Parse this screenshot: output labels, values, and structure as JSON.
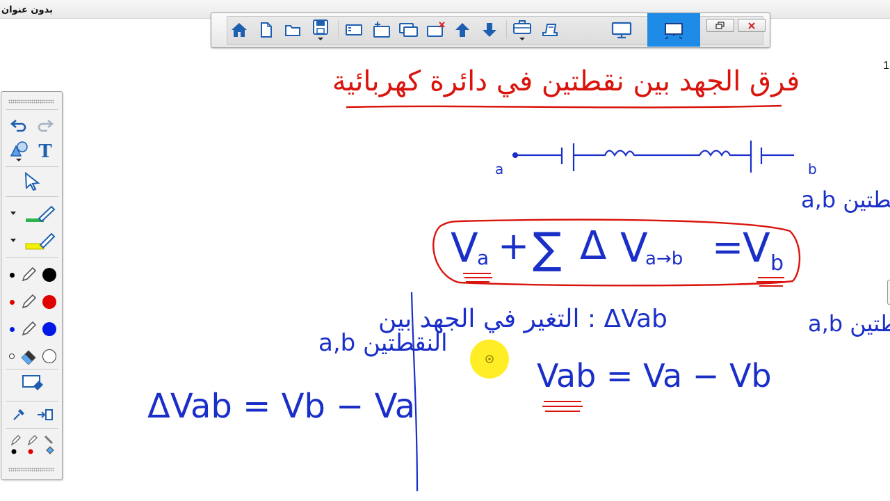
{
  "window": {
    "title": "بدون عنوان",
    "page_number": "1"
  },
  "toolbar": {
    "buttons": [
      {
        "id": "home",
        "icon": "home-icon"
      },
      {
        "id": "new",
        "icon": "new-file-icon"
      },
      {
        "id": "open",
        "icon": "open-folder-icon"
      },
      {
        "id": "save",
        "icon": "save-icon"
      },
      {
        "id": "page-list",
        "icon": "page-list-icon"
      },
      {
        "id": "add-page",
        "icon": "add-page-icon"
      },
      {
        "id": "duplicate-page",
        "icon": "duplicate-page-icon"
      },
      {
        "id": "delete-page",
        "icon": "delete-page-icon"
      },
      {
        "id": "previous-page",
        "icon": "arrow-up-icon"
      },
      {
        "id": "next-page",
        "icon": "arrow-down-icon"
      },
      {
        "id": "toolbox",
        "icon": "toolbox-icon"
      },
      {
        "id": "capture",
        "icon": "capture-icon"
      },
      {
        "id": "desktop-mode",
        "icon": "monitor-icon"
      },
      {
        "id": "whiteboard-mode",
        "icon": "whiteboard-icon",
        "active": true
      },
      {
        "id": "restore",
        "icon": "restore-window-icon"
      },
      {
        "id": "close",
        "icon": "close-icon"
      }
    ],
    "active_color": "#1e8be6"
  },
  "side_panel": {
    "text_tool_label": "T",
    "pen_colors": [
      "#000000",
      "#e00000",
      "#0019e6"
    ],
    "highlighter_colors": [
      "#2db34a",
      "#f5f000"
    ]
  },
  "board": {
    "ink_colors": {
      "red": "#d9140c",
      "blue": "#1a2fc8"
    },
    "title": "فرق الجهد بين نقطتين في دائرة كهربائية",
    "circuit_labels": [
      "a",
      "b"
    ],
    "rule_text": "قانون فرق الجهد بين النقطتين a,b",
    "main_equation": {
      "Va": "V",
      "Va_sub": "a",
      "plus": "+",
      "sigma": "∑",
      "delta": "Δ",
      "V2": "V",
      "V2_sub": "a→b",
      "eq": "=",
      "Vb": "V",
      "Vb_sub": "b"
    },
    "definition_right": "Vab : فرق الجهد بين النقطتين a,b",
    "formula_right": "Vab = Va − Vb",
    "definition_left_1": "ΔVab : التغير في الجهد بين",
    "definition_left_2": "النقطتين a,b",
    "formula_left": "ΔVab = Vb − Va"
  }
}
